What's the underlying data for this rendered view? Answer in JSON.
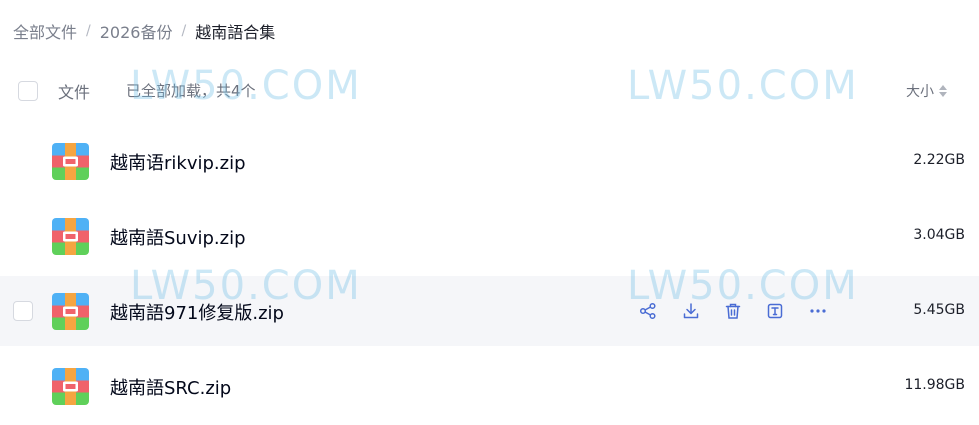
{
  "breadcrumb": {
    "items": [
      "全部文件",
      "2026备份",
      "越南語合集"
    ],
    "separator": "/"
  },
  "header": {
    "name_label": "文件",
    "load_status": "已全部加载，共4个",
    "size_label": "大小"
  },
  "files": [
    {
      "name": "越南语rikvip.zip",
      "size": "2.22GB"
    },
    {
      "name": "越南語Suvip.zip",
      "size": "3.04GB"
    },
    {
      "name": "越南語971修复版.zip",
      "size": "5.45GB"
    },
    {
      "name": "越南語SRC.zip",
      "size": "11.98GB"
    }
  ],
  "watermark": "LW50.COM",
  "icons": {
    "share": "share-icon",
    "download": "download-icon",
    "delete": "trash-icon",
    "rename": "rename-icon",
    "more": "more-icon",
    "archive": "zip-archive-icon"
  },
  "colors": {
    "accent": "#2a5bd7",
    "action_icon": "#4a6cd4",
    "hover_row": "#f5f6f9",
    "watermark": "#78c3e8"
  }
}
